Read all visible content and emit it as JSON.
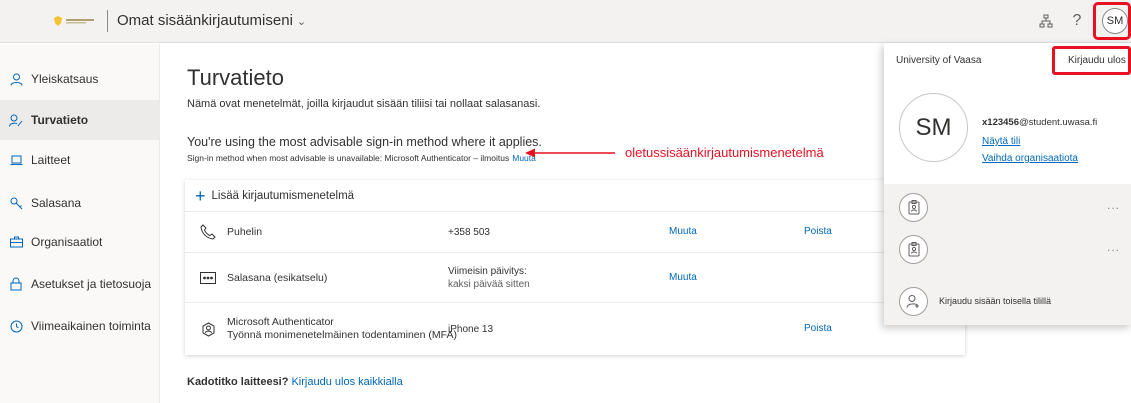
{
  "header": {
    "app_title": "Omat sisäänkirjautumiseni",
    "avatar_initials": "SM",
    "help_glyph": "?"
  },
  "sidebar": {
    "items": [
      {
        "label": "Yleiskatsaus",
        "icon": "person-icon"
      },
      {
        "label": "Turvatieto",
        "icon": "security-info-icon"
      },
      {
        "label": "Laitteet",
        "icon": "laptop-icon"
      },
      {
        "label": "Salasana",
        "icon": "key-icon"
      },
      {
        "label": "Organisaatiot",
        "icon": "briefcase-icon"
      },
      {
        "label": "Asetukset ja tietosuoja",
        "icon": "lock-icon"
      },
      {
        "label": "Viimeaikainen toiminta",
        "icon": "history-icon"
      }
    ]
  },
  "main": {
    "title": "Turvatieto",
    "subtitle": "Nämä ovat menetelmät, joilla kirjaudut sisään tiliisi tai nollaat salasanasi.",
    "advisable": "You're using the most advisable sign-in method where it applies.",
    "advisable_sub": "Sign-in method when most advisable is unavailable: Microsoft Authenticator – ilmoitus",
    "advisable_change": "Muuta",
    "add_method": "Lisää kirjautumismenetelmä",
    "methods": [
      {
        "name": "Puhelin",
        "value": "+358 503",
        "action1": "Muuta",
        "action2": "Poista",
        "icon": "phone-icon"
      },
      {
        "name": "Salasana (esikatselu)",
        "value": "Viimeisin päivitys:",
        "value_sub": "kaksi päivää sitten",
        "action1": "Muuta",
        "action2": "",
        "icon": "password-icon"
      },
      {
        "name": "Microsoft Authenticator",
        "name_sub": "Työnnä monimenetelmäinen todentaminen (MFA)",
        "value": "iPhone 13",
        "action1": "",
        "action2": "Poista",
        "icon": "authenticator-icon"
      }
    ],
    "lost_device_bold": "Kadotitko laitteesi?",
    "lost_device_link": "Kirjaudu ulos kaikkialla"
  },
  "annotation": {
    "text": "oletussisäänkirjautumismenetelmä",
    "color": "#e81123"
  },
  "flyout": {
    "org": "University of Vaasa",
    "signout": "Kirjaudu ulos",
    "avatar_initials": "SM",
    "email_bold": "x123456",
    "email_rest": "@student.uwasa.fi",
    "view_account": "Näytä tili",
    "switch_org": "Vaihda organisaatiota",
    "other_account": "Kirjaudu sisään toisella tilillä",
    "more": "..."
  },
  "colors": {
    "accent": "#0067b8",
    "highlight": "#e81123"
  }
}
